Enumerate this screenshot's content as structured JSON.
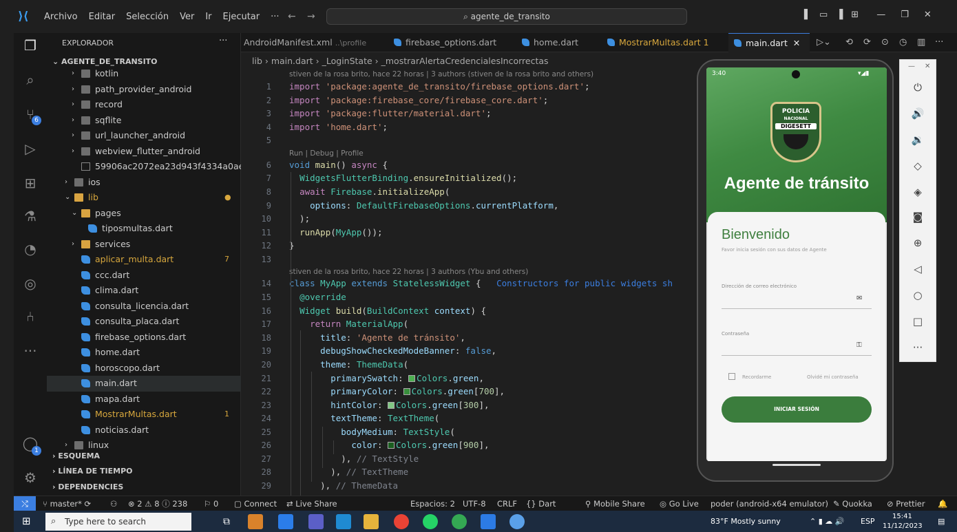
{
  "window": {
    "menu": [
      "Archivo",
      "Editar",
      "Selección",
      "Ver",
      "Ir",
      "Ejecutar",
      "···"
    ],
    "search": "agente_de_transito"
  },
  "explorer": {
    "title": "EXPLORADOR",
    "more": "···",
    "root": "AGENTE_DE_TRANSITO",
    "items": [
      {
        "label": "kotlin",
        "type": "folder",
        "depth": 1,
        "chev": "›"
      },
      {
        "label": "path_provider_android",
        "type": "folder",
        "depth": 1,
        "chev": "›"
      },
      {
        "label": "record",
        "type": "folder",
        "depth": 1,
        "chev": "›"
      },
      {
        "label": "sqflite",
        "type": "folder",
        "depth": 1,
        "chev": "›"
      },
      {
        "label": "url_launcher_android",
        "type": "folder",
        "depth": 1,
        "chev": "›"
      },
      {
        "label": "webview_flutter_android",
        "type": "folder",
        "depth": 1,
        "chev": "›"
      },
      {
        "label": "59906ac2072ea23d943f4334a0ae7...",
        "type": "file",
        "depth": 1,
        "chev": ""
      },
      {
        "label": "ios",
        "type": "folder",
        "depth": 0,
        "chev": "›"
      },
      {
        "label": "lib",
        "type": "folderopen",
        "depth": 0,
        "chev": "⌄",
        "color": "#d7a73d",
        "count": "●"
      },
      {
        "label": "pages",
        "type": "folderopen",
        "depth": 1,
        "chev": "⌄"
      },
      {
        "label": "tiposmultas.dart",
        "type": "dart",
        "depth": 2,
        "chev": ""
      },
      {
        "label": "services",
        "type": "folderopen",
        "depth": 1,
        "chev": "›"
      },
      {
        "label": "aplicar_multa.dart",
        "type": "dart",
        "depth": 1,
        "chev": "",
        "color": "#d7a73d",
        "count": "7"
      },
      {
        "label": "ccc.dart",
        "type": "dart",
        "depth": 1,
        "chev": ""
      },
      {
        "label": "clima.dart",
        "type": "dart",
        "depth": 1,
        "chev": ""
      },
      {
        "label": "consulta_licencia.dart",
        "type": "dart",
        "depth": 1,
        "chev": ""
      },
      {
        "label": "consulta_placa.dart",
        "type": "dart",
        "depth": 1,
        "chev": ""
      },
      {
        "label": "firebase_options.dart",
        "type": "dart",
        "depth": 1,
        "chev": ""
      },
      {
        "label": "home.dart",
        "type": "dart",
        "depth": 1,
        "chev": ""
      },
      {
        "label": "horoscopo.dart",
        "type": "dart",
        "depth": 1,
        "chev": ""
      },
      {
        "label": "main.dart",
        "type": "dart",
        "depth": 1,
        "chev": "",
        "selected": true
      },
      {
        "label": "mapa.dart",
        "type": "dart",
        "depth": 1,
        "chev": ""
      },
      {
        "label": "MostrarMultas.dart",
        "type": "dart",
        "depth": 1,
        "chev": "",
        "color": "#d7a73d",
        "count": "1"
      },
      {
        "label": "noticias.dart",
        "type": "dart",
        "depth": 1,
        "chev": ""
      },
      {
        "label": "linux",
        "type": "folder",
        "depth": 0,
        "chev": "›"
      }
    ],
    "sections": [
      "ESQUEMA",
      "LÍNEA DE TIEMPO",
      "DEPENDENCIES"
    ]
  },
  "tabs": [
    {
      "label": "AndroidManifest.xml",
      "suffix": "..\\profile",
      "icon": "none"
    },
    {
      "label": "firebase_options.dart",
      "icon": "dart"
    },
    {
      "label": "home.dart",
      "icon": "dart"
    },
    {
      "label": "MostrarMultas.dart",
      "suffix": "1",
      "icon": "dart",
      "color": "#d7a73d"
    },
    {
      "label": "main.dart",
      "icon": "dart",
      "active": true,
      "close": "✕"
    }
  ],
  "breadcrumb": "lib  ›  main.dart  ›  _LoginState  ›  _mostrarAlertaCredencialesIncorrectas",
  "editor": {
    "blame1": "stiven de la rosa brito, hace 22 horas | 3 authors (stiven de la rosa brito and others)",
    "codelens": "Run | Debug | Profile",
    "blame2": "stiven de la rosa brito, hace 22 horas | 3 authors (Ybu and others)",
    "line_numbers": [
      "1",
      "2",
      "3",
      "4",
      "5",
      "6",
      "7",
      "8",
      "9",
      "10",
      "11",
      "12",
      "13",
      "14",
      "15",
      "16",
      "17",
      "18",
      "19",
      "20",
      "21",
      "22",
      "23",
      "24",
      "25",
      "26",
      "27",
      "28",
      "29"
    ],
    "hint": "Constructors for public widgets sh"
  },
  "emulator": {
    "time": "3:40",
    "badge_line1": "POLICIA",
    "badge_line2": "NACIONAL",
    "badge_line3": "DIGESETT",
    "app_title": "Agente de tránsito",
    "welcome": "Bienvenido",
    "welcome_sub": "Favor inicia sesión con sus datos de Agente",
    "email_label": "Dirección de correo electrónico",
    "password_label": "Contraseña",
    "remember": "Recordarme",
    "forgot": "Olvidé mi contraseña",
    "login_button": "INICIAR SESIÓN"
  },
  "statusbar": {
    "branch": "master*",
    "problems": "⊗ 2 ⚠ 8 ⓘ 238",
    "ports": "⚐ 0",
    "connect": "Connect",
    "liveshare": "Live Share",
    "spaces": "Espacios: 2",
    "encoding": "UTF-8",
    "eol": "CRLF",
    "language": "Dart",
    "mobileshare": "Mobile Share",
    "golive": "Go Live",
    "device": "poder (android-x64 emulator)",
    "quokka": "Quokka",
    "prettier": "Prettier"
  },
  "taskbar": {
    "search_placeholder": "Type here to search",
    "weather": "83°F  Mostly sunny",
    "lang": "ESP",
    "time": "15:41",
    "date": "11/12/2023"
  },
  "colors": {
    "accent": "#3b7ee0",
    "green": "#3b7d3d",
    "modified": "#d7a73d"
  }
}
